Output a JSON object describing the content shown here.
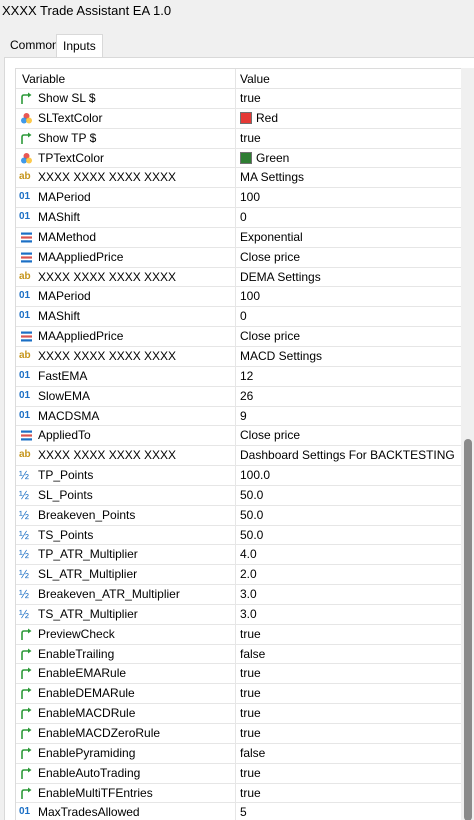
{
  "window": {
    "title": "XXXX Trade Assistant EA 1.0"
  },
  "tabs": [
    {
      "label": "Common",
      "active": false
    },
    {
      "label": "Inputs",
      "active": true
    }
  ],
  "grid": {
    "columns": {
      "variable": "Variable",
      "value": "Value"
    },
    "rows": [
      {
        "icon": "bool-arrow-icon",
        "name": "Show SL $",
        "value": "true"
      },
      {
        "icon": "color-palette-icon",
        "name": "SLTextColor",
        "value": "Red",
        "swatch": "#e53935"
      },
      {
        "icon": "bool-arrow-icon",
        "name": "Show TP $",
        "value": "true"
      },
      {
        "icon": "color-palette-icon",
        "name": "TPTextColor",
        "value": "Green",
        "swatch": "#2e7d32"
      },
      {
        "icon": "string-ab-icon",
        "name": "XXXX XXXX XXXX XXXX",
        "value": "MA Settings"
      },
      {
        "icon": "integer-01-icon",
        "name": "MAPeriod",
        "value": "100"
      },
      {
        "icon": "integer-01-icon",
        "name": "MAShift",
        "value": "0"
      },
      {
        "icon": "enum-list-icon",
        "name": "MAMethod",
        "value": "Exponential"
      },
      {
        "icon": "enum-list-icon",
        "name": "MAAppliedPrice",
        "value": "Close price"
      },
      {
        "icon": "string-ab-icon",
        "name": "XXXX XXXX XXXX XXXX",
        "value": "DEMA Settings"
      },
      {
        "icon": "integer-01-icon",
        "name": "MAPeriod",
        "value": "100"
      },
      {
        "icon": "integer-01-icon",
        "name": "MAShift",
        "value": "0"
      },
      {
        "icon": "enum-list-icon",
        "name": "MAAppliedPrice",
        "value": "Close price"
      },
      {
        "icon": "string-ab-icon",
        "name": "XXXX XXXX XXXX XXXX",
        "value": "MACD Settings"
      },
      {
        "icon": "integer-01-icon",
        "name": "FastEMA",
        "value": "12"
      },
      {
        "icon": "integer-01-icon",
        "name": "SlowEMA",
        "value": "26"
      },
      {
        "icon": "integer-01-icon",
        "name": "MACDSMA",
        "value": "9"
      },
      {
        "icon": "enum-list-icon",
        "name": "AppliedTo",
        "value": "Close price"
      },
      {
        "icon": "string-ab-icon",
        "name": "XXXX XXXX XXXX XXXX",
        "value": "Dashboard Settings For BACKTESTING"
      },
      {
        "icon": "double-half-icon",
        "name": "TP_Points",
        "value": "100.0"
      },
      {
        "icon": "double-half-icon",
        "name": "SL_Points",
        "value": "50.0"
      },
      {
        "icon": "double-half-icon",
        "name": "Breakeven_Points",
        "value": "50.0"
      },
      {
        "icon": "double-half-icon",
        "name": "TS_Points",
        "value": "50.0"
      },
      {
        "icon": "double-half-icon",
        "name": "TP_ATR_Multiplier",
        "value": "4.0"
      },
      {
        "icon": "double-half-icon",
        "name": "SL_ATR_Multiplier",
        "value": "2.0"
      },
      {
        "icon": "double-half-icon",
        "name": "Breakeven_ATR_Multiplier",
        "value": "3.0"
      },
      {
        "icon": "double-half-icon",
        "name": "TS_ATR_Multiplier",
        "value": "3.0"
      },
      {
        "icon": "bool-arrow-icon",
        "name": "PreviewCheck",
        "value": "true"
      },
      {
        "icon": "bool-arrow-icon",
        "name": "EnableTrailing",
        "value": "false"
      },
      {
        "icon": "bool-arrow-icon",
        "name": "EnableEMARule",
        "value": "true"
      },
      {
        "icon": "bool-arrow-icon",
        "name": "EnableDEMARule",
        "value": "true"
      },
      {
        "icon": "bool-arrow-icon",
        "name": "EnableMACDRule",
        "value": "true"
      },
      {
        "icon": "bool-arrow-icon",
        "name": "EnableMACDZeroRule",
        "value": "true"
      },
      {
        "icon": "bool-arrow-icon",
        "name": "EnablePyramiding",
        "value": "false"
      },
      {
        "icon": "bool-arrow-icon",
        "name": "EnableAutoTrading",
        "value": "true"
      },
      {
        "icon": "bool-arrow-icon",
        "name": "EnableMultiTFEntries",
        "value": "true"
      },
      {
        "icon": "integer-01-icon",
        "name": "MaxTradesAllowed",
        "value": "5"
      }
    ]
  },
  "colors": {
    "bool_icon": "#2e9a3a",
    "string_icon": "#c5951b",
    "int_icon": "#1b6fc5",
    "enum_icon": "#1b6fc5",
    "scroll_thumb": "#8a8a8a"
  }
}
